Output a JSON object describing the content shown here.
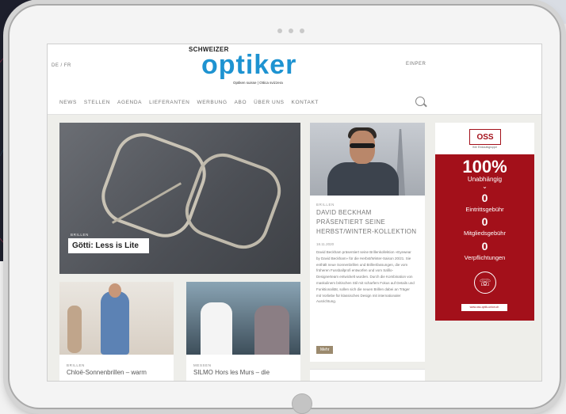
{
  "header": {
    "lang": "DE / FR",
    "logo_top": "SCHWEIZER",
    "logo_word": "optiker",
    "logo_sub": "Optiken suisse | Ottica svizzera",
    "login": "EINPER"
  },
  "nav": {
    "items": [
      "NEWS",
      "STELLEN",
      "AGENDA",
      "LIEFERANTEN",
      "WERBUNG",
      "ABO",
      "ÜBER UNS",
      "KONTAKT"
    ]
  },
  "hero": {
    "tag": "BRILLEN",
    "title": "Götti: Less is Lite"
  },
  "cards": [
    {
      "tag": "BRILLEN",
      "title": "Chloë-Sonnenbrillen – warm"
    },
    {
      "tag": "MESSEN",
      "title": "SILMO Hors les Murs – die"
    }
  ],
  "article": {
    "tag": "BRILLEN",
    "title": "DAVID BECKHAM PRÄSENTIERT SEINE HERBST/WINTER-KOLLEKTION",
    "date": "18.11.2020",
    "body": "David Beckham präsentiert seine Brillenkollektion «Eyewear by David Beckham» für die Herbst/Winter-Saison 20/21. Sie enthält neue Sonnenbrillen und Brillenfassungen, die vom früheren Fussballprofi entworfen und vom Safilo-Designerteam entwickelt wurden. Durch die Kombination von maskulinem britischen Stil mit scharfem Fokus auf Details und Funktionalität, sollen sich die neuen Brillen dabei an Träger mit Vorliebe für klassisches Design mit internationaler Ausrichtung.",
    "more": "Mehr"
  },
  "ad": {
    "logo": "OSS",
    "tagline": "Ihre Einkaufsgruppe",
    "big": "100%",
    "unab": "Unabhängig",
    "chev": "⌄",
    "num1": "0",
    "lab1": "Eintrittsgebühr",
    "num2": "0",
    "lab2": "Mitgliedsgebühr",
    "num3": "0",
    "lab3": "Verpflichtungen",
    "url": "www.oss-optik-union.ch"
  },
  "colors": {
    "brand_blue": "#1e93d1",
    "ad_red": "#a3101a",
    "more_button": "#9b8a6e"
  }
}
